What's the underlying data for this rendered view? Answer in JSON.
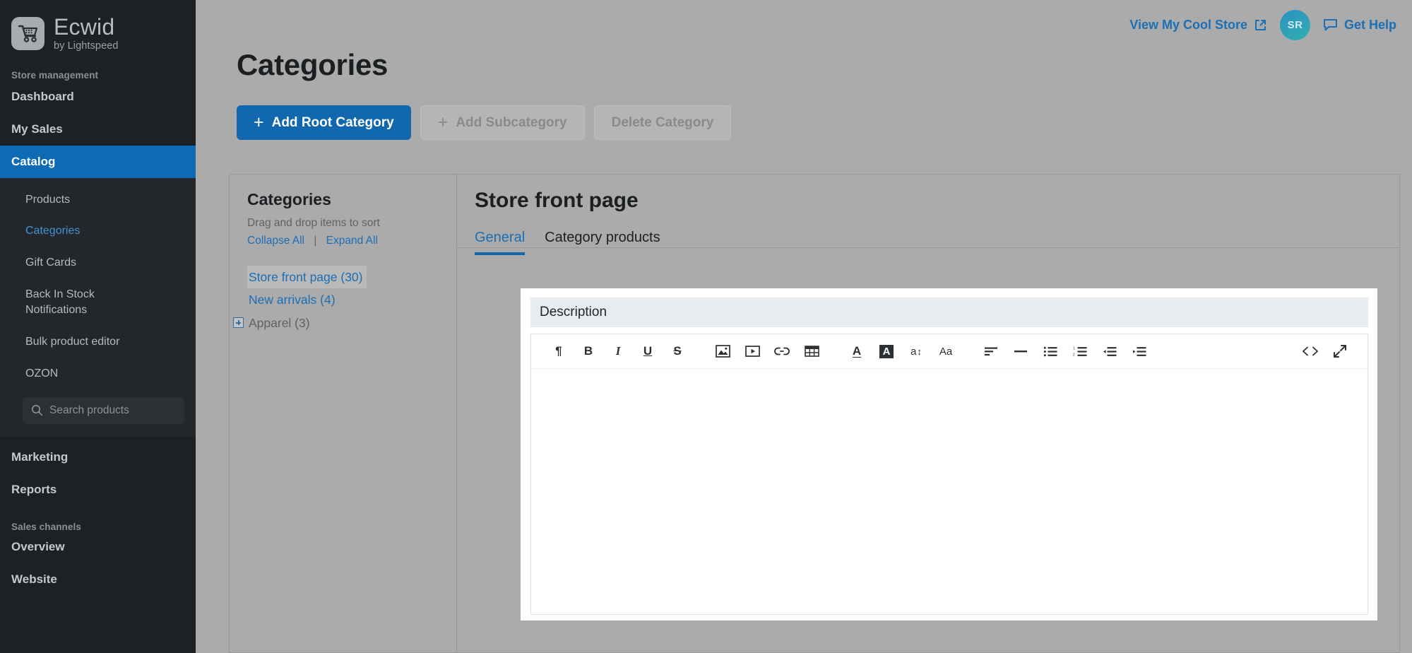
{
  "brand": {
    "name": "Ecwid",
    "tagline": "by Lightspeed",
    "logo_icon": "shopping-cart-icon"
  },
  "sidebar": {
    "section_store": "Store management",
    "nav": [
      {
        "label": "Dashboard",
        "active": false
      },
      {
        "label": "My Sales",
        "active": false
      },
      {
        "label": "Catalog",
        "active": true
      }
    ],
    "catalog_subnav": [
      {
        "label": "Products",
        "link": false
      },
      {
        "label": "Categories",
        "link": true
      },
      {
        "label": "Gift Cards",
        "link": false
      },
      {
        "label": "Back In Stock Notifications",
        "link": false
      },
      {
        "label": "Bulk product editor",
        "link": false
      },
      {
        "label": "OZON",
        "link": false
      }
    ],
    "search": {
      "placeholder": "Search products",
      "value": "",
      "icon": "search-icon"
    },
    "nav_bottom": [
      {
        "label": "Marketing"
      },
      {
        "label": "Reports"
      }
    ],
    "section_sales": "Sales channels",
    "sales_channels": [
      {
        "label": "Overview"
      },
      {
        "label": "Website"
      }
    ],
    "accent_active": "#0d6ab4",
    "background": "#1d2124"
  },
  "header": {
    "store_link": "View My Cool Store",
    "store_link_icon": "external-link-icon",
    "avatar_initials": "SR",
    "help_label": "Get Help",
    "help_icon": "chat-bubble-icon",
    "link_color": "#1b6fb5"
  },
  "page": {
    "title": "Categories",
    "buttons": [
      {
        "label": "Add Root Category",
        "style": "primary",
        "icon": "plus-icon",
        "disabled": false
      },
      {
        "label": "Add Subcategory",
        "style": "ghost",
        "icon": "plus-icon",
        "disabled": true
      },
      {
        "label": "Delete Category",
        "style": "ghost",
        "icon": "none",
        "disabled": true
      }
    ]
  },
  "tree": {
    "title": "Categories",
    "hint": "Drag and drop items to sort",
    "collapse_all": "Collapse All",
    "separator": "|",
    "expand_all": "Expand All",
    "items": [
      {
        "label": "Store front page (30)",
        "selected": true,
        "expandable": false,
        "muted": false
      },
      {
        "label": "New arrivals (4)",
        "selected": false,
        "expandable": false,
        "muted": false
      },
      {
        "label": "Apparel (3)",
        "selected": false,
        "expandable": true,
        "muted": true
      }
    ]
  },
  "detail": {
    "title": "Store front page",
    "tabs": [
      {
        "label": "General",
        "active": true
      },
      {
        "label": "Category products",
        "active": false
      }
    ]
  },
  "editor": {
    "field_label": "Description",
    "content": "",
    "toolbar": [
      {
        "name": "paragraph-icon",
        "glyph": "¶"
      },
      {
        "name": "bold-icon",
        "glyph": "B"
      },
      {
        "name": "italic-icon",
        "glyph": "I"
      },
      {
        "name": "underline-icon",
        "glyph": "U"
      },
      {
        "name": "strikethrough-icon",
        "glyph": "S"
      },
      {
        "name": "insert-image-icon",
        "glyph": ""
      },
      {
        "name": "insert-video-icon",
        "glyph": ""
      },
      {
        "name": "insert-link-icon",
        "glyph": ""
      },
      {
        "name": "insert-table-icon",
        "glyph": ""
      },
      {
        "name": "text-color-icon",
        "glyph": "A"
      },
      {
        "name": "highlight-color-icon",
        "glyph": "A"
      },
      {
        "name": "font-size-icon",
        "glyph": "a"
      },
      {
        "name": "text-case-icon",
        "glyph": "Aa"
      },
      {
        "name": "align-icon",
        "glyph": ""
      },
      {
        "name": "horizontal-rule-icon",
        "glyph": ""
      },
      {
        "name": "bullet-list-icon",
        "glyph": ""
      },
      {
        "name": "numbered-list-icon",
        "glyph": ""
      },
      {
        "name": "outdent-icon",
        "glyph": ""
      },
      {
        "name": "indent-icon",
        "glyph": ""
      },
      {
        "name": "source-code-icon",
        "glyph": "<>"
      },
      {
        "name": "fullscreen-icon",
        "glyph": ""
      }
    ]
  }
}
